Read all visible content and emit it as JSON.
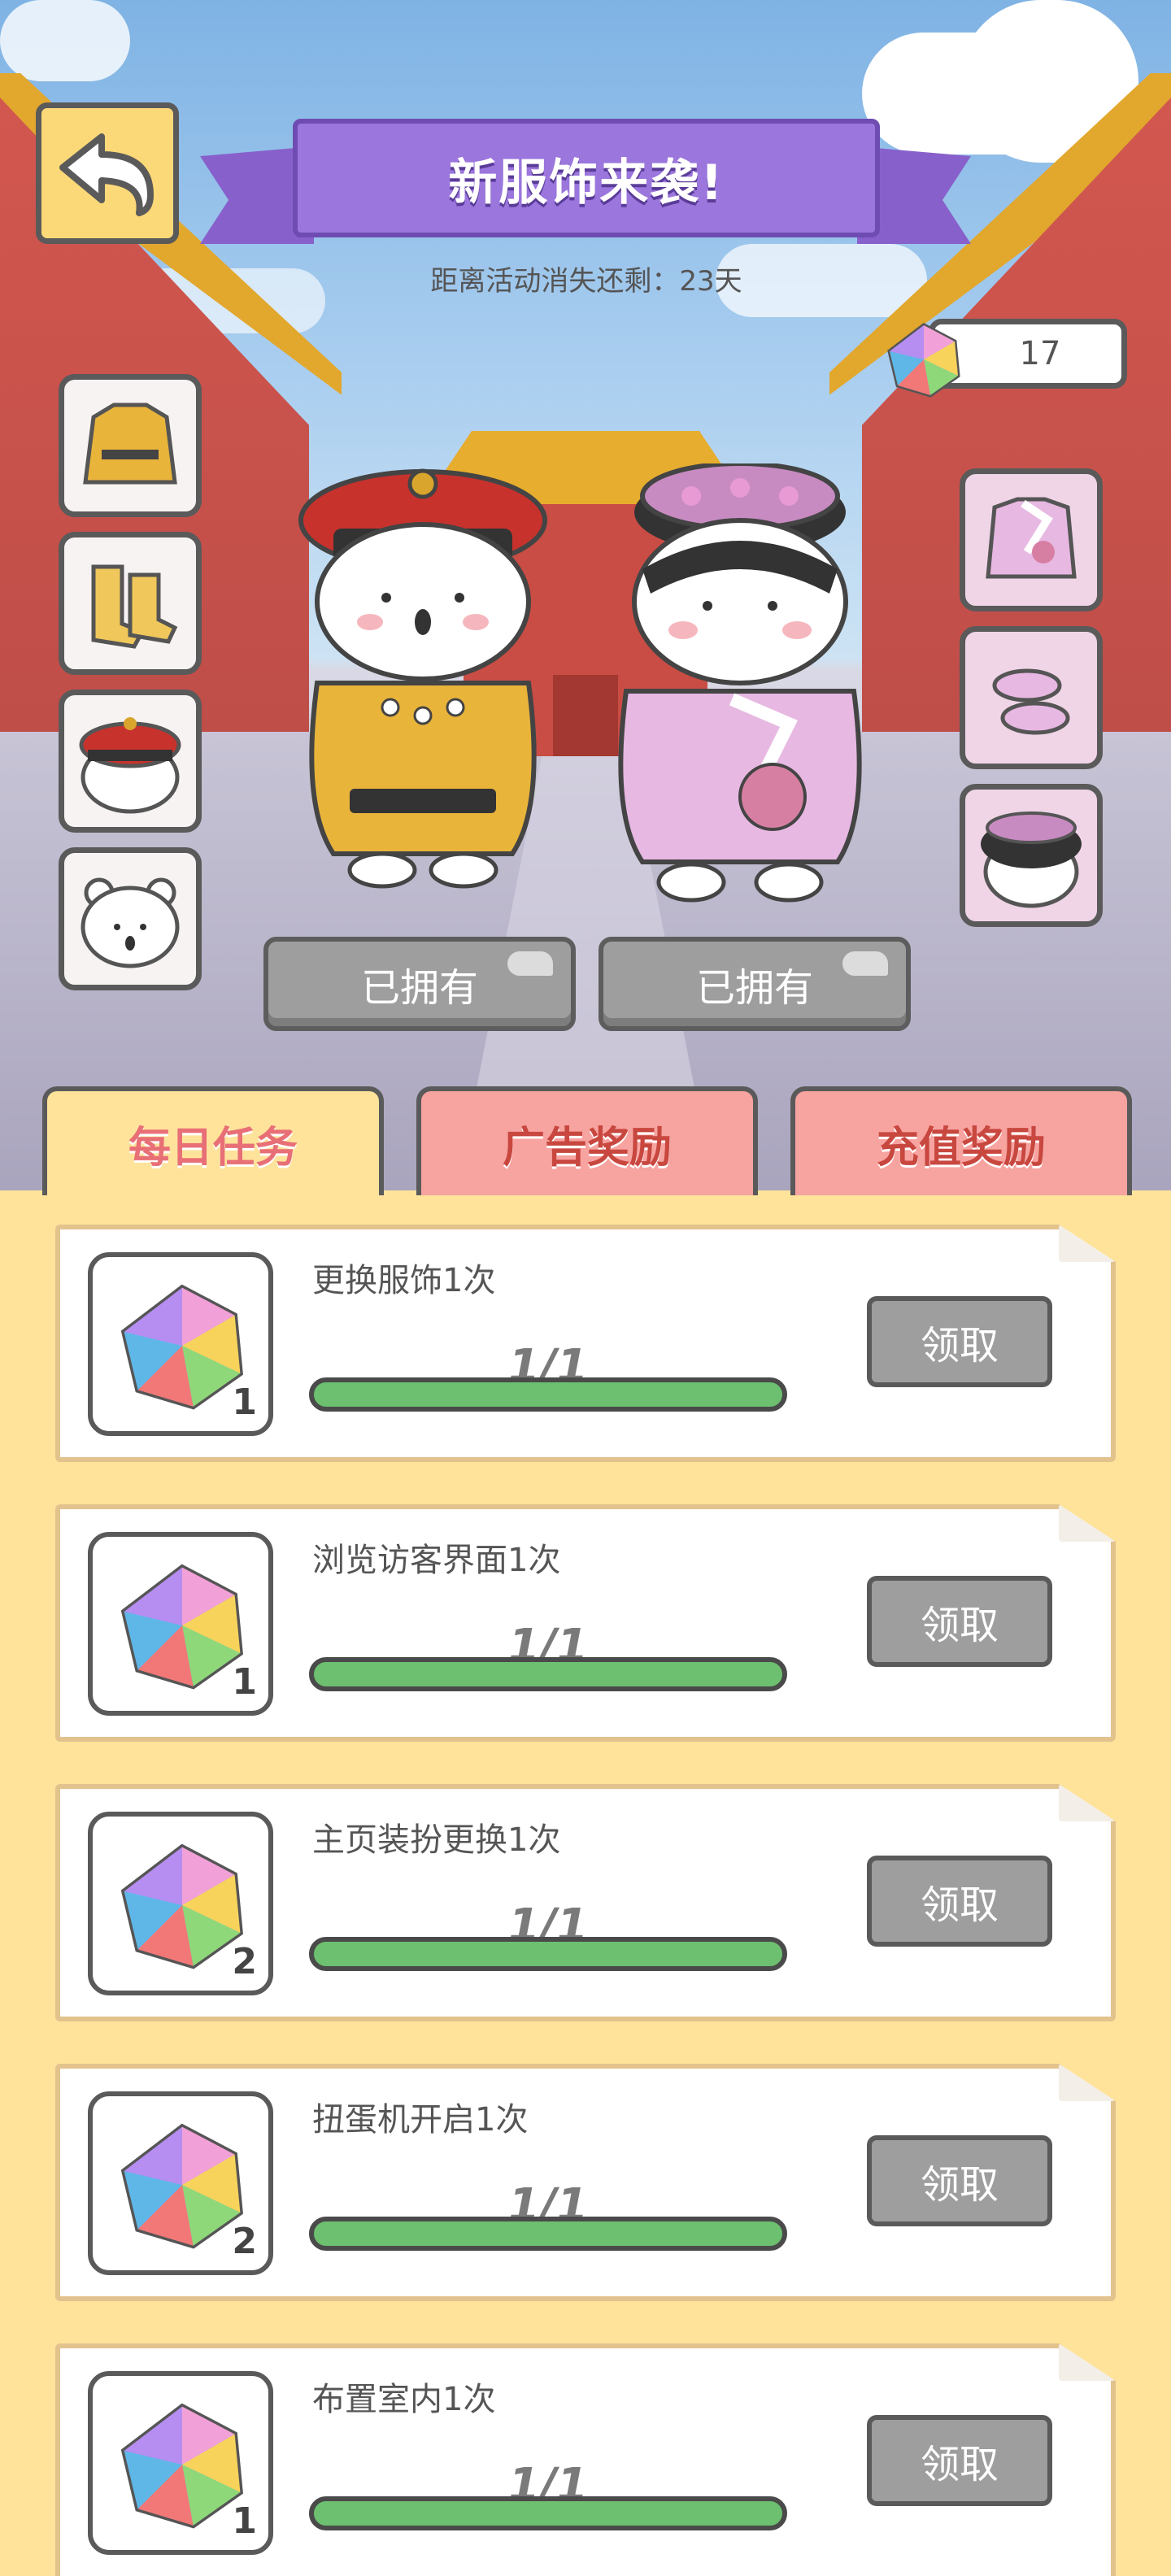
{
  "header": {
    "title": "新服饰来袭!",
    "countdown": "距离活动消失还剩：23天"
  },
  "currency": {
    "gem_count": "17",
    "icon": "rainbow-gem-icon"
  },
  "slots": {
    "left": [
      "emperor-robe",
      "emperor-boots",
      "emperor-hat",
      "bear-face"
    ],
    "right": [
      "consort-robe",
      "consort-shoes",
      "consort-headdress"
    ]
  },
  "characters": {
    "owned_left": "已拥有",
    "owned_right": "已拥有"
  },
  "tabs": [
    {
      "label": "每日任务",
      "active": true
    },
    {
      "label": "广告奖励",
      "active": false
    },
    {
      "label": "充值奖励",
      "active": false
    }
  ],
  "tasks": [
    {
      "name": "更换服饰1次",
      "reward_qty": "1",
      "progress": "1/1",
      "progress_fraction": 1.0,
      "button": "领取"
    },
    {
      "name": "浏览访客界面1次",
      "reward_qty": "1",
      "progress": "1/1",
      "progress_fraction": 1.0,
      "button": "领取"
    },
    {
      "name": "主页装扮更换1次",
      "reward_qty": "2",
      "progress": "1/1",
      "progress_fraction": 1.0,
      "button": "领取"
    },
    {
      "name": "扭蛋机开启1次",
      "reward_qty": "2",
      "progress": "1/1",
      "progress_fraction": 1.0,
      "button": "领取"
    },
    {
      "name": "布置室内1次",
      "reward_qty": "1",
      "progress": "1/1",
      "progress_fraction": 1.0,
      "button": "领取"
    }
  ],
  "colors": {
    "accent_purple": "#9b76dc",
    "panel_yellow": "#ffe39b",
    "progress_green": "#6cc06f",
    "tab_active_text": "#e86f76"
  }
}
